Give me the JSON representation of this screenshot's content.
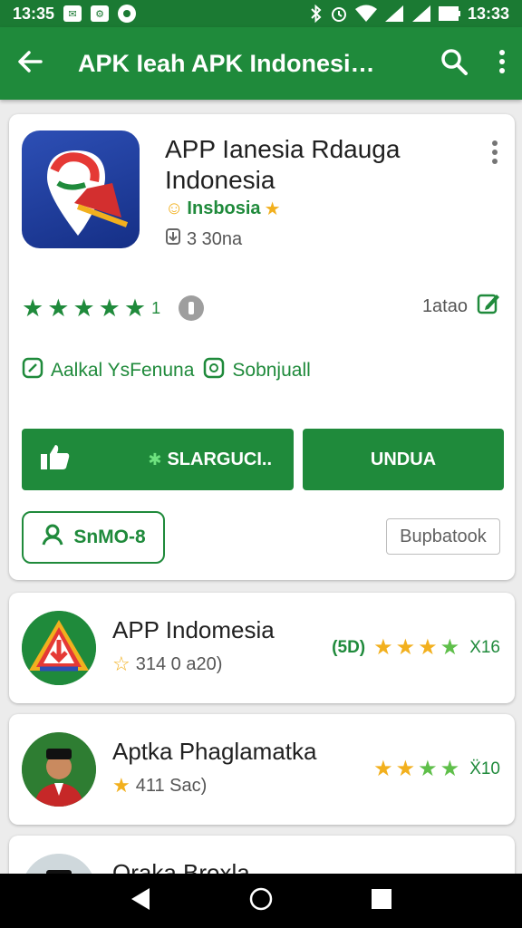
{
  "status_bar": {
    "time_left": "13:35",
    "time_right": "13:33",
    "icons": [
      "notification-icon",
      "settings-icon",
      "record-icon",
      "bluetooth-icon",
      "alarm-icon",
      "wifi-icon",
      "signal-icon",
      "signal-icon",
      "battery-icon"
    ]
  },
  "toolbar": {
    "title": "APK Ieah APK Indonesia...",
    "icons": [
      "back-arrow-icon",
      "search-icon",
      "more-vert-icon"
    ]
  },
  "app": {
    "title": "APP Ianesia Rdauga Indonesia",
    "developer": "Insbosia",
    "downloads": "3 30na",
    "rating_count": "1",
    "rate_label": "1atao",
    "tags": [
      "Aalkal YsFenuna",
      "Sobnjuall"
    ],
    "like_button": "SLARGUCI..",
    "install_button": "UNDUA",
    "outline_chip": "SnMO-8",
    "grey_chip": "Bupbatook"
  },
  "related": [
    {
      "name": "APP Indomesia",
      "sub": "314 0 a20)",
      "rating_label": "(5D)",
      "count": "X16"
    },
    {
      "name": "Aptka Phaglamatka",
      "sub": "411 Sac)",
      "rating_label": "",
      "count": "Ẍ10"
    },
    {
      "name": "Oraka Broxla",
      "sub": ""
    }
  ],
  "nav": {
    "icons": [
      "back-triangle-icon",
      "home-circle-icon",
      "recents-square-icon"
    ]
  },
  "colors": {
    "primary": "#1f8a3b",
    "status_bar": "#1b7a33",
    "star_yellow": "#f2b01e"
  }
}
